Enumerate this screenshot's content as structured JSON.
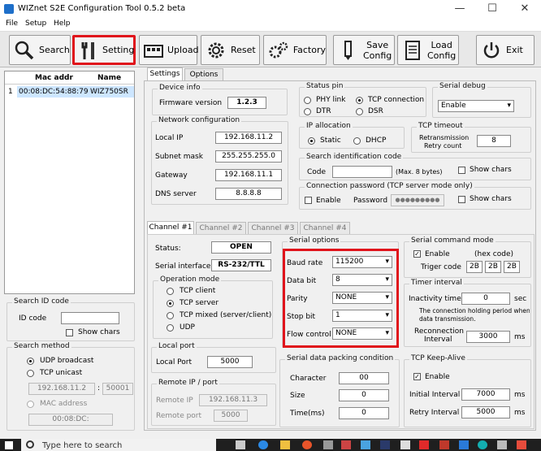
{
  "window": {
    "title": "WIZnet S2E Configuration Tool 0.5.2 beta",
    "controls": [
      "—",
      "☐",
      "✕"
    ]
  },
  "menu": [
    "File",
    "Setup",
    "Help"
  ],
  "toolbar": {
    "search": "Search",
    "setting": "Setting",
    "upload": "Upload",
    "reset": "Reset",
    "factory": "Factory",
    "save_1": "Save",
    "save_2": "Config",
    "load_1": "Load",
    "load_2": "Config",
    "exit": "Exit"
  },
  "device_list": {
    "headers": [
      "Mac addr",
      "Name"
    ],
    "rows": [
      {
        "idx": "1",
        "mac": "00:08:DC:54:88:79",
        "name": "WIZ750SR"
      }
    ]
  },
  "search_id": {
    "title": "Search ID code",
    "label": "ID code",
    "show_chars": "Show chars"
  },
  "search_method": {
    "title": "Search method",
    "udp": "UDP broadcast",
    "tcp": "TCP unicast",
    "ip": "192.168.11.2",
    "sep": ":",
    "port": "50001",
    "mac_label": "MAC address",
    "mac": "00:08:DC:"
  },
  "tabs": {
    "settings": "Settings",
    "options": "Options"
  },
  "device_info": {
    "title": "Device info",
    "fw_label": "Firmware version",
    "fw": "1.2.3"
  },
  "network": {
    "title": "Network configuration",
    "local_ip_label": "Local IP",
    "local_ip": "192.168.11.2",
    "subnet_label": "Subnet mask",
    "subnet": "255.255.255.0",
    "gateway_label": "Gateway",
    "gateway": "192.168.11.1",
    "dns_label": "DNS server",
    "dns": "8.8.8.8"
  },
  "status_pin": {
    "title": "Status pin",
    "phy": "PHY link",
    "dtr": "DTR",
    "tcp": "TCP connection",
    "dsr": "DSR"
  },
  "serial_debug": {
    "title": "Serial debug",
    "value": "Enable"
  },
  "ip_alloc": {
    "title": "IP allocation",
    "static": "Static",
    "dhcp": "DHCP"
  },
  "tcp_timeout": {
    "title": "TCP timeout",
    "label1": "Retransmission",
    "label2": "Retry count",
    "value": "8"
  },
  "search_ident": {
    "title": "Search identification code",
    "code_label": "Code",
    "hint": "(Max. 8 bytes)",
    "show": "Show chars"
  },
  "conn_pw": {
    "title": "Connection password (TCP server mode only)",
    "enable": "Enable",
    "pw_label": "Password",
    "pw": "●●●●●●●●●",
    "show": "Show chars"
  },
  "channel_tabs": [
    "Channel #1",
    "Channel #2",
    "Channel #3",
    "Channel #4"
  ],
  "channel": {
    "status_label": "Status:",
    "status": "OPEN",
    "iface_label": "Serial interface:",
    "iface": "RS-232/TTL"
  },
  "op_mode": {
    "title": "Operation mode",
    "client": "TCP client",
    "server": "TCP server",
    "mixed": "TCP mixed (server/client)",
    "udp": "UDP"
  },
  "local_port": {
    "title": "Local port",
    "label": "Local Port",
    "value": "5000"
  },
  "remote": {
    "title": "Remote IP / port",
    "ip_label": "Remote IP",
    "ip": "192.168.11.3",
    "port_label": "Remote port",
    "port": "5000"
  },
  "serial_options": {
    "title": "Serial options",
    "baud_label": "Baud rate",
    "baud": "115200",
    "data_label": "Data bit",
    "data": "8",
    "parity_label": "Parity",
    "parity": "NONE",
    "stop_label": "Stop bit",
    "stop": "1",
    "flow_label": "Flow control",
    "flow": "NONE"
  },
  "packing": {
    "title": "Serial data packing condition",
    "char_label": "Character",
    "char": "00",
    "size_label": "Size",
    "size": "0",
    "time_label": "Time(ms)",
    "time": "0"
  },
  "cmd_mode": {
    "title": "Serial command mode",
    "enable": "Enable",
    "hex": "(hex code)",
    "trigger_label": "Triger code",
    "codes": [
      "2B",
      "2B",
      "2B"
    ]
  },
  "timer": {
    "title": "Timer interval",
    "inact_label": "Inactivity timer",
    "inact": "0",
    "unit": "sec",
    "note1": "The connection holding period when n",
    "note2": "data transmission.",
    "recon_label1": "Reconnection",
    "recon_label2": "Interval",
    "recon": "3000",
    "recon_unit": "ms"
  },
  "keepalive": {
    "title": "TCP Keep-Alive",
    "enable": "Enable",
    "init_label": "Initial Interval",
    "init": "7000",
    "init_unit": "ms",
    "retry_label": "Retry Interval",
    "retry": "5000",
    "retry_unit": "ms"
  },
  "taskbar": {
    "search": "Type here to search"
  },
  "colors": {
    "highlight_border": "#e0131b",
    "selection": "#cde6ff"
  }
}
